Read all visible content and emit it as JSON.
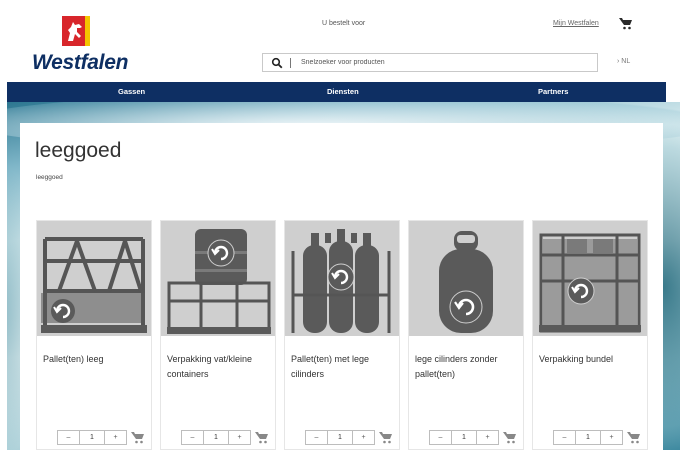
{
  "header": {
    "brand": "Westfalen",
    "order_for": "U bestelt voor",
    "my_account": "Mijn Westfalen",
    "search_placeholder": "Snelzoeker voor producten",
    "language": "› NL"
  },
  "nav": {
    "items": [
      {
        "label": "Gassen"
      },
      {
        "label": "Diensten"
      },
      {
        "label": "Partners"
      }
    ]
  },
  "page": {
    "title": "leeggoed",
    "breadcrumb": "leeggoed"
  },
  "products": [
    {
      "title": "Pallet(ten) leeg",
      "qty": "1",
      "minus": "–",
      "plus": "+"
    },
    {
      "title": "Verpakking vat/kleine containers",
      "qty": "1",
      "minus": "–",
      "plus": "+"
    },
    {
      "title": "Pallet(ten) met lege cilinders",
      "qty": "1",
      "minus": "–",
      "plus": "+"
    },
    {
      "title": "lege cilinders zonder pallet(ten)",
      "qty": "1",
      "minus": "–",
      "plus": "+"
    },
    {
      "title": "Verpakking bundel",
      "qty": "1",
      "minus": "–",
      "plus": "+"
    }
  ],
  "colors": {
    "brand_navy": "#0e2f63",
    "logo_red": "#d8262b",
    "logo_yellow": "#f4c400",
    "product_grey": "#5a5a5a"
  },
  "icons": {
    "search": "search-icon",
    "cart": "cart-icon",
    "return": "return-arrow-icon"
  }
}
